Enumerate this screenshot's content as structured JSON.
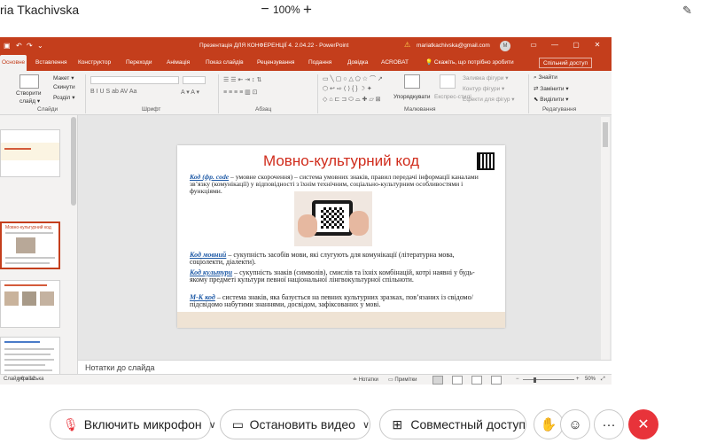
{
  "meeting": {
    "presenter_name": "ria Tkachivska",
    "zoom_minus": "−",
    "zoom_level": "100%",
    "zoom_plus": "+",
    "pen_icon": "pen-icon"
  },
  "powerpoint": {
    "quick_access": [
      "↶",
      "↷",
      "⌄"
    ],
    "doc_title": "Презентація ДЛЯ КОНФЕРЕНЦІЇ 4.  2.04.22  -  PowerPoint",
    "account_email": "mariatkachivska@gmail.com",
    "avatar_initial": "M",
    "window_buttons": [
      "▭",
      "—",
      "▢",
      "✕"
    ],
    "tabs": [
      "Основне",
      "Вставлення",
      "Конструктор",
      "Переходи",
      "Анімація",
      "Показ слайдів",
      "Рецензування",
      "Подання",
      "Довідка",
      "ACROBAT"
    ],
    "active_tab": "Основне",
    "tell_me": "Скажіть, що потрібно зробити",
    "share_button": "Спільний доступ",
    "ribbon": {
      "new_slide_line1": "Створити",
      "new_slide_line2": "слайд ▾",
      "layout": "Макет ▾",
      "reset": "Скинути",
      "section": "Розділ ▾",
      "groups": [
        "Слайди",
        "Шрифт",
        "Абзац",
        "Малювання",
        "Редагування"
      ],
      "arrange": "Упорядкувати",
      "quick_styles": "Експрес-стилі",
      "shape_fill": "Заливка фігури ▾",
      "shape_outline": "Контур фігури ▾",
      "shape_effects": "Ефекти для фігур ▾",
      "find": "Знайти",
      "replace": "Замінити ▾",
      "select": "Виділити ▾"
    },
    "slide": {
      "title": "Мовно-культурний код",
      "para1_term": "Код (фр. code",
      "para1_text": " – умовне скорочення) – система умовних знаків, правил передачі інформації каналами зв’язку (комунікації) у відповідності з їхнім технічним, соціально-культурним особливостями і функціями.",
      "para2_term": "Код мовний",
      "para2_text": " – сукупність засобів мови, які слугують для комунікації (літературна мова, соціолекти, діалекти).",
      "para3_term": "Код культури",
      "para3_text": " – сукупність знаків (символів), смислів та їхніх комбінацій, котрі наявні у будь-якому предметі культури певної національної лінгвокультурної спільноти.",
      "para4_term": "М-К код",
      "para4_text": " – система знаків, яка базується на певних культурних зразках, пов’язаних із свідомо/підсвідомо набутими знаннями, досвідом, зафіксованих у мові."
    },
    "notes_placeholder": "Нотатки до слайда",
    "status": {
      "slide_info": "Слайд 6 з 12",
      "language": "українська",
      "notes": "≐ Нотатки",
      "comments": "▭ Примітки",
      "zoom": "50%"
    },
    "thumbnails": {
      "slide5_caption": "Мовно-культурний код",
      "slide7_caption": "..."
    }
  },
  "controls": {
    "mic_label": "Включить микрофон",
    "video_label": "Остановить видео",
    "share_label": "Совместный доступ",
    "hand_icon": "hand-icon",
    "reactions_icon": "reactions-icon",
    "more_label": "···",
    "hangup_label": "✕"
  }
}
